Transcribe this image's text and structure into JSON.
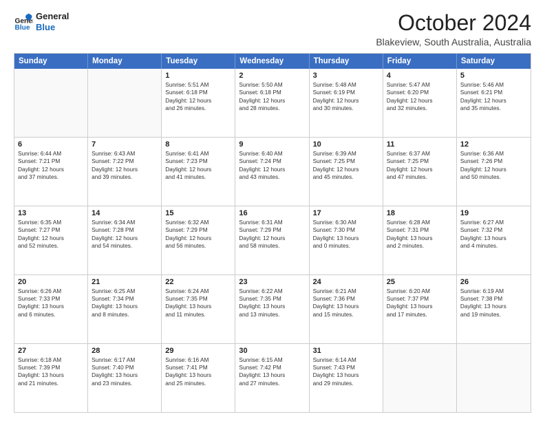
{
  "logo": {
    "line1": "General",
    "line2": "Blue"
  },
  "title": "October 2024",
  "subtitle": "Blakeview, South Australia, Australia",
  "header_days": [
    "Sunday",
    "Monday",
    "Tuesday",
    "Wednesday",
    "Thursday",
    "Friday",
    "Saturday"
  ],
  "weeks": [
    [
      {
        "day": "",
        "lines": [],
        "empty": true
      },
      {
        "day": "",
        "lines": [],
        "empty": true
      },
      {
        "day": "1",
        "lines": [
          "Sunrise: 5:51 AM",
          "Sunset: 6:18 PM",
          "Daylight: 12 hours",
          "and 26 minutes."
        ]
      },
      {
        "day": "2",
        "lines": [
          "Sunrise: 5:50 AM",
          "Sunset: 6:18 PM",
          "Daylight: 12 hours",
          "and 28 minutes."
        ]
      },
      {
        "day": "3",
        "lines": [
          "Sunrise: 5:48 AM",
          "Sunset: 6:19 PM",
          "Daylight: 12 hours",
          "and 30 minutes."
        ]
      },
      {
        "day": "4",
        "lines": [
          "Sunrise: 5:47 AM",
          "Sunset: 6:20 PM",
          "Daylight: 12 hours",
          "and 32 minutes."
        ]
      },
      {
        "day": "5",
        "lines": [
          "Sunrise: 5:46 AM",
          "Sunset: 6:21 PM",
          "Daylight: 12 hours",
          "and 35 minutes."
        ]
      }
    ],
    [
      {
        "day": "6",
        "lines": [
          "Sunrise: 6:44 AM",
          "Sunset: 7:21 PM",
          "Daylight: 12 hours",
          "and 37 minutes."
        ]
      },
      {
        "day": "7",
        "lines": [
          "Sunrise: 6:43 AM",
          "Sunset: 7:22 PM",
          "Daylight: 12 hours",
          "and 39 minutes."
        ]
      },
      {
        "day": "8",
        "lines": [
          "Sunrise: 6:41 AM",
          "Sunset: 7:23 PM",
          "Daylight: 12 hours",
          "and 41 minutes."
        ]
      },
      {
        "day": "9",
        "lines": [
          "Sunrise: 6:40 AM",
          "Sunset: 7:24 PM",
          "Daylight: 12 hours",
          "and 43 minutes."
        ]
      },
      {
        "day": "10",
        "lines": [
          "Sunrise: 6:39 AM",
          "Sunset: 7:25 PM",
          "Daylight: 12 hours",
          "and 45 minutes."
        ]
      },
      {
        "day": "11",
        "lines": [
          "Sunrise: 6:37 AM",
          "Sunset: 7:25 PM",
          "Daylight: 12 hours",
          "and 47 minutes."
        ]
      },
      {
        "day": "12",
        "lines": [
          "Sunrise: 6:36 AM",
          "Sunset: 7:26 PM",
          "Daylight: 12 hours",
          "and 50 minutes."
        ]
      }
    ],
    [
      {
        "day": "13",
        "lines": [
          "Sunrise: 6:35 AM",
          "Sunset: 7:27 PM",
          "Daylight: 12 hours",
          "and 52 minutes."
        ]
      },
      {
        "day": "14",
        "lines": [
          "Sunrise: 6:34 AM",
          "Sunset: 7:28 PM",
          "Daylight: 12 hours",
          "and 54 minutes."
        ]
      },
      {
        "day": "15",
        "lines": [
          "Sunrise: 6:32 AM",
          "Sunset: 7:29 PM",
          "Daylight: 12 hours",
          "and 56 minutes."
        ]
      },
      {
        "day": "16",
        "lines": [
          "Sunrise: 6:31 AM",
          "Sunset: 7:29 PM",
          "Daylight: 12 hours",
          "and 58 minutes."
        ]
      },
      {
        "day": "17",
        "lines": [
          "Sunrise: 6:30 AM",
          "Sunset: 7:30 PM",
          "Daylight: 13 hours",
          "and 0 minutes."
        ]
      },
      {
        "day": "18",
        "lines": [
          "Sunrise: 6:28 AM",
          "Sunset: 7:31 PM",
          "Daylight: 13 hours",
          "and 2 minutes."
        ]
      },
      {
        "day": "19",
        "lines": [
          "Sunrise: 6:27 AM",
          "Sunset: 7:32 PM",
          "Daylight: 13 hours",
          "and 4 minutes."
        ]
      }
    ],
    [
      {
        "day": "20",
        "lines": [
          "Sunrise: 6:26 AM",
          "Sunset: 7:33 PM",
          "Daylight: 13 hours",
          "and 6 minutes."
        ]
      },
      {
        "day": "21",
        "lines": [
          "Sunrise: 6:25 AM",
          "Sunset: 7:34 PM",
          "Daylight: 13 hours",
          "and 8 minutes."
        ]
      },
      {
        "day": "22",
        "lines": [
          "Sunrise: 6:24 AM",
          "Sunset: 7:35 PM",
          "Daylight: 13 hours",
          "and 11 minutes."
        ]
      },
      {
        "day": "23",
        "lines": [
          "Sunrise: 6:22 AM",
          "Sunset: 7:35 PM",
          "Daylight: 13 hours",
          "and 13 minutes."
        ]
      },
      {
        "day": "24",
        "lines": [
          "Sunrise: 6:21 AM",
          "Sunset: 7:36 PM",
          "Daylight: 13 hours",
          "and 15 minutes."
        ]
      },
      {
        "day": "25",
        "lines": [
          "Sunrise: 6:20 AM",
          "Sunset: 7:37 PM",
          "Daylight: 13 hours",
          "and 17 minutes."
        ]
      },
      {
        "day": "26",
        "lines": [
          "Sunrise: 6:19 AM",
          "Sunset: 7:38 PM",
          "Daylight: 13 hours",
          "and 19 minutes."
        ]
      }
    ],
    [
      {
        "day": "27",
        "lines": [
          "Sunrise: 6:18 AM",
          "Sunset: 7:39 PM",
          "Daylight: 13 hours",
          "and 21 minutes."
        ]
      },
      {
        "day": "28",
        "lines": [
          "Sunrise: 6:17 AM",
          "Sunset: 7:40 PM",
          "Daylight: 13 hours",
          "and 23 minutes."
        ]
      },
      {
        "day": "29",
        "lines": [
          "Sunrise: 6:16 AM",
          "Sunset: 7:41 PM",
          "Daylight: 13 hours",
          "and 25 minutes."
        ]
      },
      {
        "day": "30",
        "lines": [
          "Sunrise: 6:15 AM",
          "Sunset: 7:42 PM",
          "Daylight: 13 hours",
          "and 27 minutes."
        ]
      },
      {
        "day": "31",
        "lines": [
          "Sunrise: 6:14 AM",
          "Sunset: 7:43 PM",
          "Daylight: 13 hours",
          "and 29 minutes."
        ]
      },
      {
        "day": "",
        "lines": [],
        "empty": true
      },
      {
        "day": "",
        "lines": [],
        "empty": true
      }
    ]
  ]
}
